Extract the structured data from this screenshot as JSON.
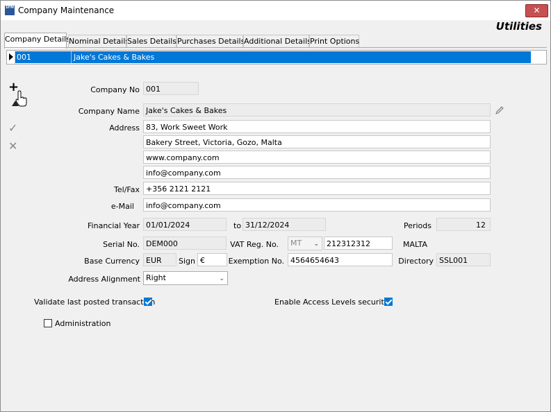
{
  "window": {
    "title": "Company Maintenance",
    "app_icon": "SFM",
    "close_symbol": "✕"
  },
  "header": {
    "utilities": "Utilities"
  },
  "tabs": [
    "Company Details",
    "Nominal Details",
    "Sales Details",
    "Purchases Details",
    "Additional Details",
    "Print Options"
  ],
  "grid": {
    "code": "001",
    "name": "Jake's Cakes & Bakes"
  },
  "form": {
    "company_no_label": "Company No",
    "company_no": "001",
    "company_name_label": "Company Name",
    "company_name": "Jake's Cakes & Bakes",
    "address_label": "Address",
    "address": [
      "83, Work Sweet Work",
      "Bakery Street, Victoria, Gozo, Malta",
      "www.company.com",
      "info@company.com"
    ],
    "telfax_label": "Tel/Fax",
    "telfax": "+356 2121 2121",
    "email_label": "e-Mail",
    "email": "info@company.com",
    "financial_year_label": "Financial Year",
    "fy_from": "01/01/2024",
    "to_label": "to",
    "fy_to": "31/12/2024",
    "periods_label": "Periods",
    "periods": "12",
    "serial_label": "Serial No.",
    "serial": "DEM000",
    "vat_label": "VAT Reg. No.",
    "vat_country": "MT",
    "vat_no": "212312312",
    "vat_country_name": "MALTA",
    "currency_label": "Base Currency",
    "currency": "EUR",
    "sign_label": "Sign",
    "sign": "€",
    "exemption_label": "Exemption No.",
    "exemption": "4564654643",
    "directory_label": "Directory",
    "directory": "SSL001",
    "alignment_label": "Address Alignment",
    "alignment": "Right",
    "validate_label": "Validate last posted transaction",
    "validate_checked": true,
    "access_label": "Enable Access Levels security",
    "access_checked": true,
    "admin_label": "Administration",
    "admin_checked": false
  },
  "icons": [
    "plus-icon",
    "hand-cursor-icon",
    "check-icon",
    "cancel-x-icon",
    "pencil-icon",
    "chevron-down-icon"
  ]
}
